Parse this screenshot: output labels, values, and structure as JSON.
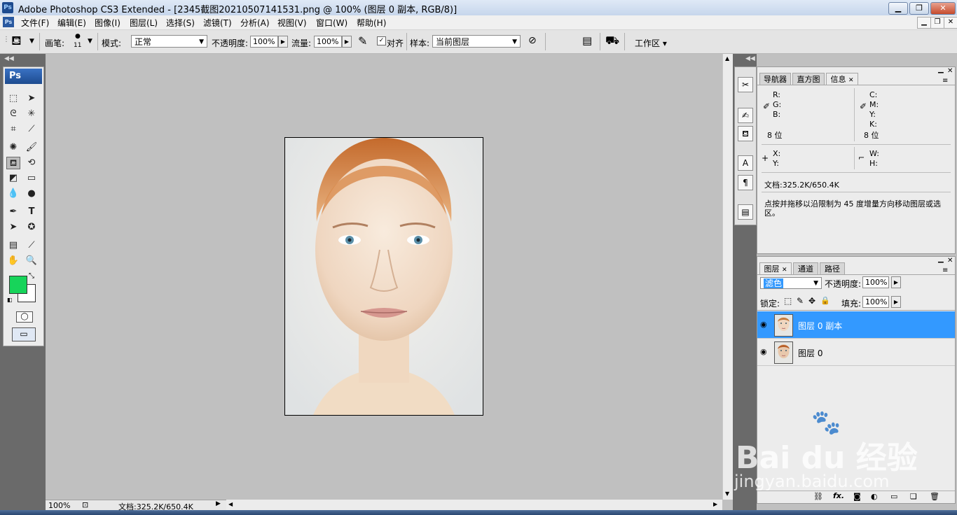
{
  "window": {
    "title": "Adobe Photoshop CS3 Extended - [2345截图20210507141531.png @ 100% (图层 0 副本, RGB/8)]",
    "app_icon": "Ps",
    "min_icon": "minimize-icon",
    "restore_icon": "restore-icon",
    "close_icon": "close-icon"
  },
  "menu": {
    "items": [
      "文件(F)",
      "编辑(E)",
      "图像(I)",
      "图层(L)",
      "选择(S)",
      "滤镜(T)",
      "分析(A)",
      "视图(V)",
      "窗口(W)",
      "帮助(H)"
    ]
  },
  "options": {
    "brush_label": "画笔:",
    "brush_size": "11",
    "mode_label": "模式:",
    "mode_value": "正常",
    "opacity_label": "不透明度:",
    "opacity_value": "100%",
    "flow_label": "流量:",
    "flow_value": "100%",
    "align_label": "对齐",
    "sample_label": "样本:",
    "sample_value": "当前图层",
    "workspace_label": "工作区 ▾"
  },
  "toolbox": {
    "logo": "Ps",
    "foreground_color": "#17d45a",
    "background_color": "#ffffff"
  },
  "info_panel": {
    "tabs": [
      "导航器",
      "直方图",
      "信息"
    ],
    "active_tab": "信息",
    "rgb": [
      "R:",
      "G:",
      "B:"
    ],
    "cmyk": [
      "C:",
      "M:",
      "Y:",
      "K:"
    ],
    "bit_left": "8 位",
    "bit_right": "8 位",
    "xy": [
      "X:",
      "Y:"
    ],
    "wh": [
      "W:",
      "H:"
    ],
    "doc": "文档:325.2K/650.4K",
    "hint": "点按并拖移以沿限制为 45 度增量方向移动图层或选区。"
  },
  "layers_panel": {
    "tabs": [
      "图层",
      "通道",
      "路径"
    ],
    "active_tab": "图层",
    "blend_mode": "滤色",
    "opacity_label": "不透明度:",
    "opacity_value": "100%",
    "lock_label": "锁定:",
    "fill_label": "填充:",
    "fill_value": "100%",
    "layers": [
      {
        "name": "图层 0 副本",
        "selected": true
      },
      {
        "name": "图层 0",
        "selected": false
      }
    ]
  },
  "status": {
    "zoom": "100%",
    "doc": "文档:325.2K/650.4K"
  },
  "watermark": {
    "brand": "Bai du 经验",
    "url": "jingyan.baidu.com"
  },
  "colors": {
    "selection_blue": "#3399ff",
    "title_gradient_top": "#dfe9f6",
    "canvas_bg": "#c0c0c0"
  }
}
